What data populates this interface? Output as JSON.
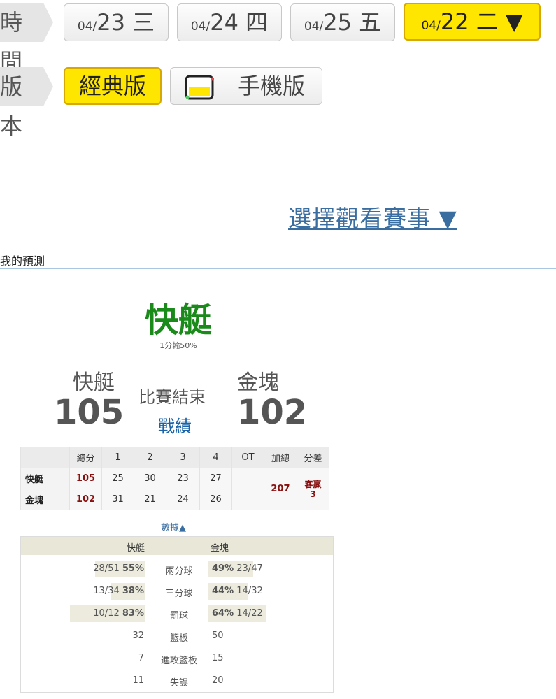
{
  "time_row": {
    "label": "時間",
    "dates": [
      {
        "prefix": "04/",
        "day": "23",
        "weekday": "三"
      },
      {
        "prefix": "04/",
        "day": "24",
        "weekday": "四"
      },
      {
        "prefix": "04/",
        "day": "25",
        "weekday": "五"
      }
    ],
    "selected": {
      "prefix": "04/",
      "day": "22",
      "weekday": "二",
      "arrow": "▼"
    }
  },
  "version_row": {
    "label": "版本",
    "classic": "經典版",
    "mobile": "手機版",
    "mobile_icon": "phone-icon"
  },
  "select_match": "選擇觀看賽事 ▼",
  "prediction_tab": "我的預測",
  "prediction": {
    "winner": "快艇",
    "note": "1分輸50%"
  },
  "game": {
    "away_team": "快艇",
    "home_team": "金塊",
    "away_score": "105",
    "home_score": "102",
    "status": "比賽結束",
    "record_link": "戰績"
  },
  "quarter_table": {
    "headers": [
      "總分",
      "1",
      "2",
      "3",
      "4",
      "OT",
      "加總",
      "分差"
    ],
    "rows": [
      {
        "team": "快艇",
        "total": "105",
        "q": [
          "25",
          "30",
          "23",
          "27"
        ],
        "ot": ""
      },
      {
        "team": "金塊",
        "total": "102",
        "q": [
          "31",
          "21",
          "24",
          "26"
        ],
        "ot": ""
      }
    ],
    "sum": "207",
    "diff_label": "客贏",
    "diff_value": "3"
  },
  "data_toggle": "數據▲",
  "stats": {
    "away": "快艇",
    "home": "金塊",
    "rows": [
      {
        "label": "兩分球",
        "away_made": "28/51",
        "away_pct": "55%",
        "home_pct": "49%",
        "home_made": "23/47",
        "away_frac": 0.55,
        "home_frac": 0.49
      },
      {
        "label": "三分球",
        "away_made": "13/34",
        "away_pct": "38%",
        "home_pct": "44%",
        "home_made": "14/32",
        "away_frac": 0.38,
        "home_frac": 0.44
      },
      {
        "label": "罰球",
        "away_made": "10/12",
        "away_pct": "83%",
        "home_pct": "64%",
        "home_made": "14/22",
        "away_frac": 0.83,
        "home_frac": 0.64
      },
      {
        "label": "籃板",
        "away_value": "32",
        "home_value": "50"
      },
      {
        "label": "進攻籃板",
        "away_value": "7",
        "home_value": "15"
      },
      {
        "label": "失誤",
        "away_value": "11",
        "home_value": "20"
      }
    ]
  }
}
